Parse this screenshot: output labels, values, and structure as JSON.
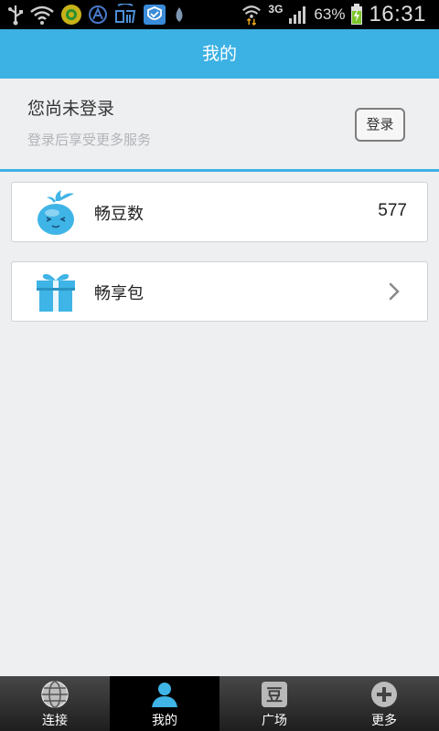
{
  "status_bar": {
    "icons": [
      "usb-icon",
      "wifi-icon",
      "app-icon",
      "app-icon",
      "chang-app-icon",
      "shield-app-icon",
      "drop-icon",
      "wifi-icon",
      "signal-icon",
      "battery-icon"
    ],
    "network": "3G",
    "battery": "63%",
    "time": "16:31"
  },
  "header": {
    "title": "我的"
  },
  "login": {
    "title": "您尚未登录",
    "subtitle": "登录后享受更多服务",
    "button_label": "登录"
  },
  "cards": [
    {
      "label": "畅豆数",
      "value": "577",
      "icon": "bean-mascot-icon"
    },
    {
      "label": "畅享包",
      "icon": "gift-icon"
    }
  ],
  "bottom_nav": {
    "items": [
      {
        "label": "连接",
        "icon": "globe-icon"
      },
      {
        "label": "我的",
        "icon": "person-icon"
      },
      {
        "label": "广场",
        "icon": "dou-icon",
        "icon_text": "豆"
      },
      {
        "label": "更多",
        "icon": "plus-icon"
      }
    ],
    "active_index": 1
  },
  "colors": {
    "accent": "#3cb1e4",
    "background": "#eeeff1"
  }
}
